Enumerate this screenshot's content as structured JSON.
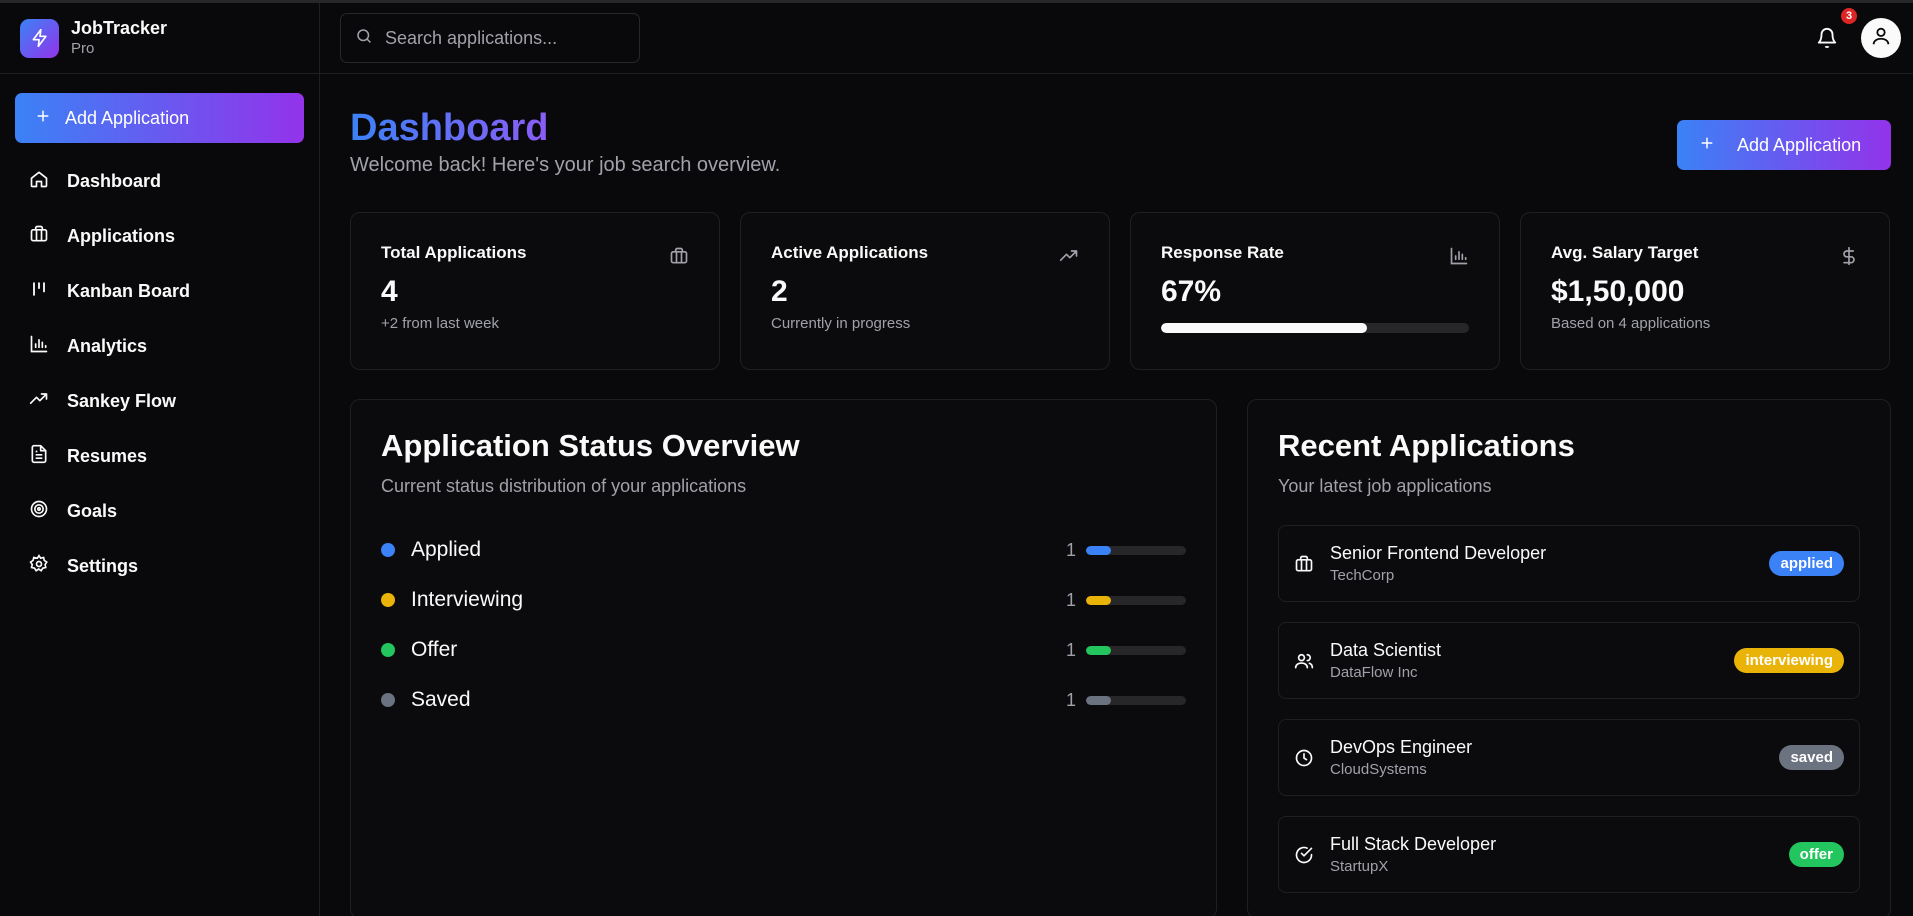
{
  "app": {
    "name": "JobTracker",
    "tier": "Pro"
  },
  "sidebar": {
    "add_label": "Add Application",
    "items": [
      {
        "label": "Dashboard",
        "icon": "home-icon"
      },
      {
        "label": "Applications",
        "icon": "briefcase-icon"
      },
      {
        "label": "Kanban Board",
        "icon": "kanban-icon"
      },
      {
        "label": "Analytics",
        "icon": "bar-chart-icon"
      },
      {
        "label": "Sankey Flow",
        "icon": "trending-up-icon"
      },
      {
        "label": "Resumes",
        "icon": "file-text-icon"
      },
      {
        "label": "Goals",
        "icon": "target-icon"
      },
      {
        "label": "Settings",
        "icon": "gear-icon"
      }
    ]
  },
  "topbar": {
    "search_placeholder": "Search applications...",
    "notification_count": "3"
  },
  "header": {
    "title": "Dashboard",
    "subtitle": "Welcome back! Here's your job search overview.",
    "add_label": "Add Application"
  },
  "stats": [
    {
      "label": "Total Applications",
      "value": "4",
      "note": "+2 from last week",
      "icon": "briefcase-icon"
    },
    {
      "label": "Active Applications",
      "value": "2",
      "note": "Currently in progress",
      "icon": "trending-up-icon"
    },
    {
      "label": "Response Rate",
      "value": "67%",
      "progress": 0.67,
      "icon": "bar-chart-icon"
    },
    {
      "label": "Avg. Salary Target",
      "value": "$1,50,000",
      "note": "Based on 4 applications",
      "icon": "dollar-icon"
    }
  ],
  "status_overview": {
    "title": "Application Status Overview",
    "subtitle": "Current status distribution of your applications",
    "rows": [
      {
        "name": "Applied",
        "count": "1",
        "fraction": 0.25,
        "color": "#3b82f6"
      },
      {
        "name": "Interviewing",
        "count": "1",
        "fraction": 0.25,
        "color": "#eab308"
      },
      {
        "name": "Offer",
        "count": "1",
        "fraction": 0.25,
        "color": "#22c55e"
      },
      {
        "name": "Saved",
        "count": "1",
        "fraction": 0.25,
        "color": "#6b7280"
      }
    ]
  },
  "recent": {
    "title": "Recent Applications",
    "subtitle": "Your latest job applications",
    "items": [
      {
        "title": "Senior Frontend Developer",
        "company": "TechCorp",
        "status": "applied",
        "color": "#3b82f6",
        "icon": "briefcase-icon"
      },
      {
        "title": "Data Scientist",
        "company": "DataFlow Inc",
        "status": "interviewing",
        "color": "#eab308",
        "icon": "users-icon"
      },
      {
        "title": "DevOps Engineer",
        "company": "CloudSystems",
        "status": "saved",
        "color": "#6b7280",
        "icon": "clock-icon"
      },
      {
        "title": "Full Stack Developer",
        "company": "StartupX",
        "status": "offer",
        "color": "#22c55e",
        "icon": "check-circle-icon"
      }
    ]
  }
}
